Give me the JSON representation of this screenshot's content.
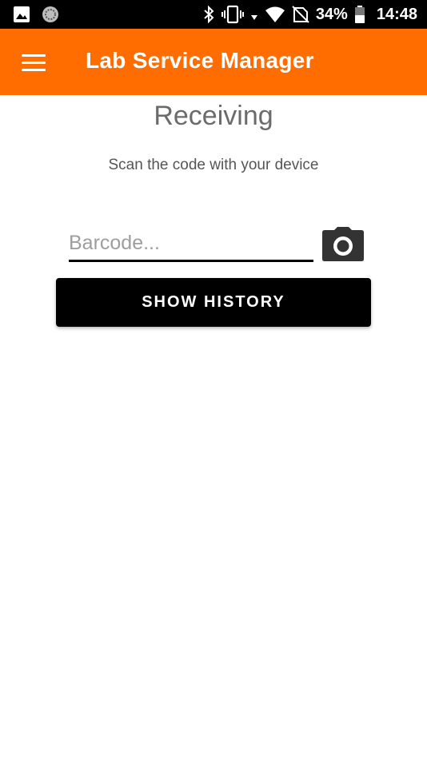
{
  "status_bar": {
    "battery_percent": "34%",
    "time": "14:48",
    "left_icons": [
      "image-icon",
      "sync-icon"
    ],
    "right_icons": [
      "bluetooth-icon",
      "vibrate-icon",
      "data-arrow-icon",
      "wifi-icon",
      "no-sim-icon",
      "battery-icon"
    ]
  },
  "app_bar": {
    "title": "Lab Service Manager",
    "background": "#ff6d00",
    "menu_icon": "hamburger-menu-icon"
  },
  "main": {
    "title": "Receiving",
    "subtitle": "Scan the code with your device",
    "barcode": {
      "value": "",
      "placeholder": "Barcode..."
    },
    "camera_icon": "camera-icon",
    "history_button_label": "SHOW HISTORY"
  }
}
